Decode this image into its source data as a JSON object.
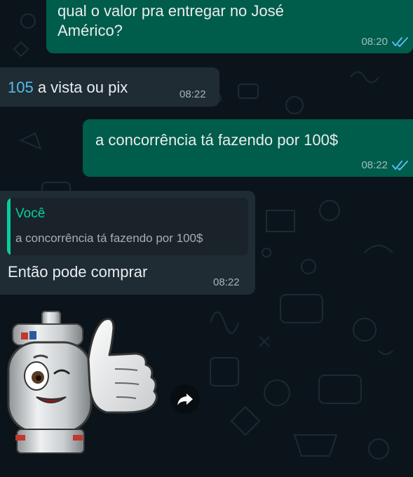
{
  "messages": [
    {
      "direction": "outgoing",
      "lines": [
        "qual o valor pra entregar no José",
        "Américo?"
      ],
      "time": "08:20",
      "status": "read"
    },
    {
      "direction": "incoming",
      "highlight": "105",
      "text": " a vista ou pix",
      "time": "08:22"
    },
    {
      "direction": "outgoing",
      "text": "a concorrência tá fazendo por 100$",
      "time": "08:22",
      "status": "read"
    },
    {
      "direction": "incoming",
      "quote": {
        "author": "Você",
        "text": "a concorrência tá fazendo por 100$"
      },
      "text": "Então pode comprar",
      "time": "08:22"
    }
  ],
  "sticker": {
    "description": "gas-cylinder-mascot-thumbs-up-sticker"
  },
  "icons": {
    "read_receipt": "double-check-icon",
    "forward": "forward-icon"
  },
  "colors": {
    "background": "#0b141a",
    "outgoing_bubble": "#005c4b",
    "incoming_bubble": "#1f2c34",
    "quote_accent": "#06cf9c",
    "read_ticks": "#53bdeb",
    "link_number": "#53bdeb"
  }
}
